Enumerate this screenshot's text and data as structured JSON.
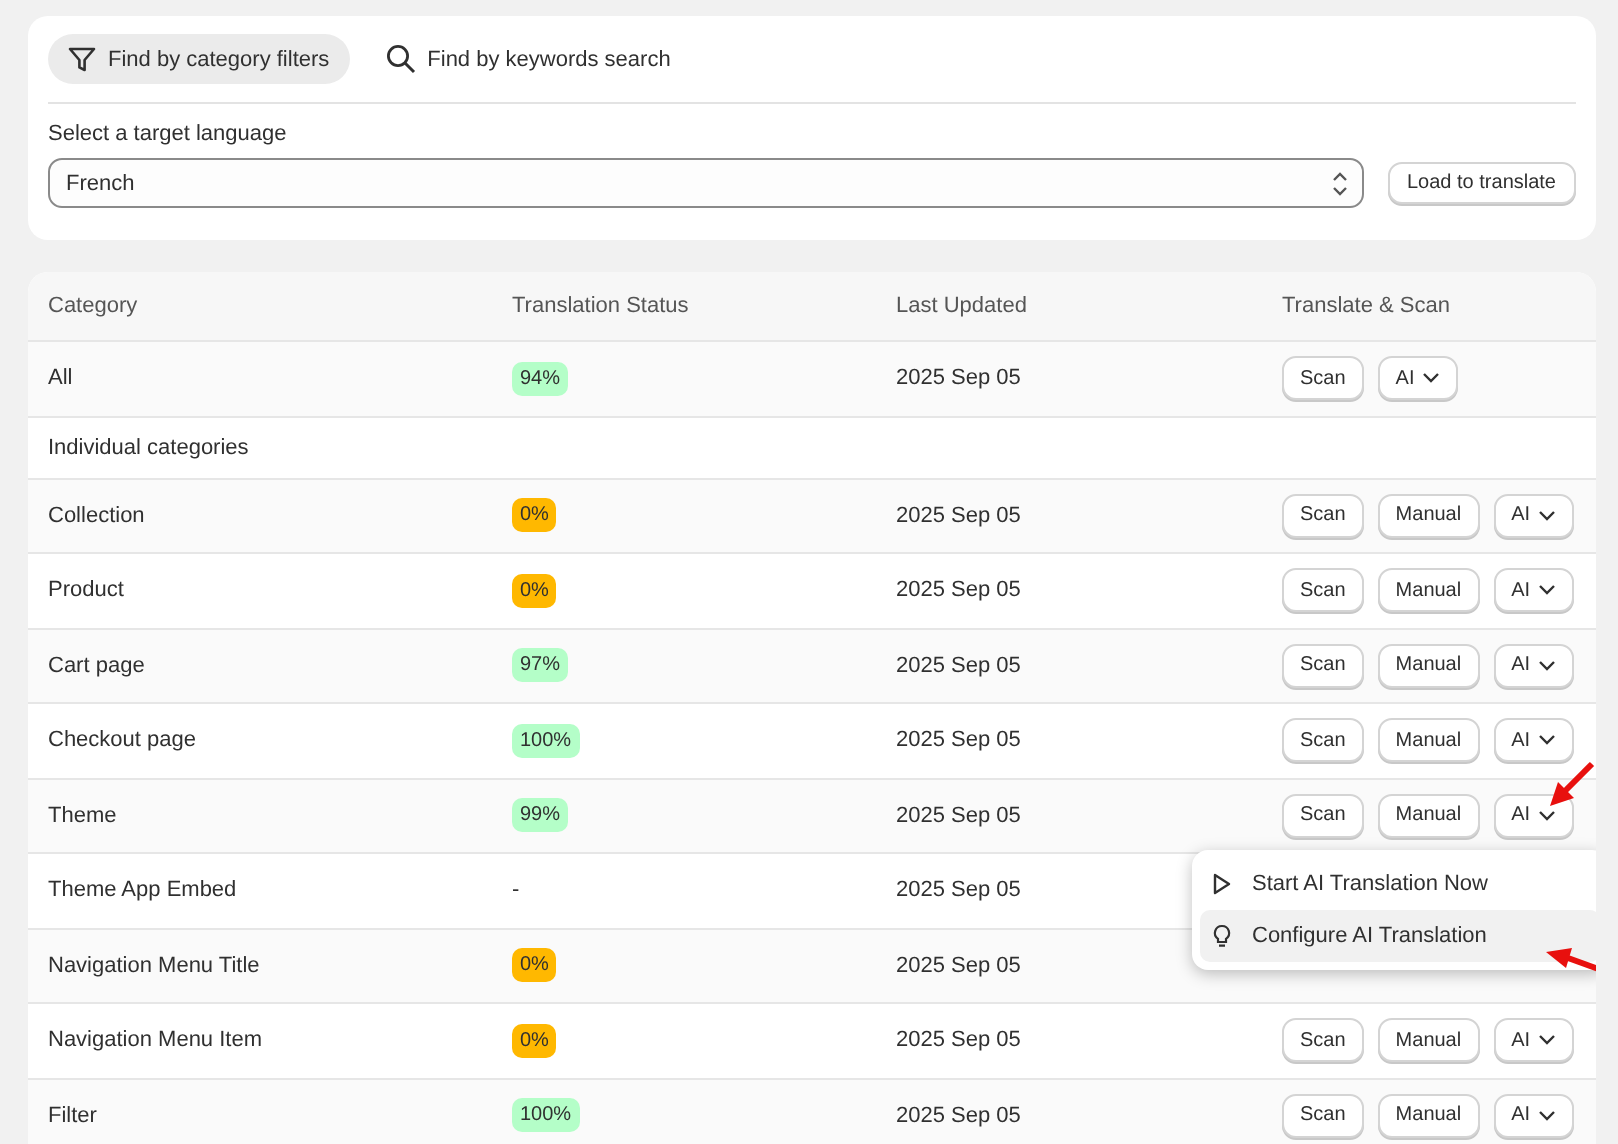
{
  "search_modes": [
    {
      "label": "Find by category filters",
      "selected": true
    },
    {
      "label": "Find by keywords search",
      "selected": false
    }
  ],
  "language": {
    "label": "Select a target language",
    "value": "French",
    "button": "Load to translate"
  },
  "table": {
    "columns": [
      "Category",
      "Translation Status",
      "Last Updated",
      "Translate & Scan"
    ],
    "rows": [
      {
        "kind": "item",
        "category": "All",
        "status": "94%",
        "color": "#b4fec8",
        "updated": "2025 Sep 05",
        "buttons": [
          "Scan",
          "AI"
        ]
      },
      {
        "kind": "heading",
        "category": "Individual categories"
      },
      {
        "kind": "item",
        "category": "Collection",
        "status": "0%",
        "color": "#ffb800",
        "updated": "2025 Sep 05",
        "buttons": [
          "Scan",
          "Manual",
          "AI"
        ]
      },
      {
        "kind": "item",
        "category": "Product",
        "status": "0%",
        "color": "#ffb800",
        "updated": "2025 Sep 05",
        "buttons": [
          "Scan",
          "Manual",
          "AI"
        ]
      },
      {
        "kind": "item",
        "category": "Cart page",
        "status": "97%",
        "color": "#b4fec8",
        "updated": "2025 Sep 05",
        "buttons": [
          "Scan",
          "Manual",
          "AI"
        ]
      },
      {
        "kind": "item",
        "category": "Checkout page",
        "status": "100%",
        "color": "#b4fec8",
        "updated": "2025 Sep 05",
        "buttons": [
          "Scan",
          "Manual",
          "AI"
        ]
      },
      {
        "kind": "item",
        "category": "Theme",
        "status": "99%",
        "color": "#b4fec8",
        "updated": "2025 Sep 05",
        "buttons": [
          "Scan",
          "Manual",
          "AI"
        ]
      },
      {
        "kind": "item",
        "category": "Theme App Embed",
        "status": "-",
        "updated": "2025 Sep 05"
      },
      {
        "kind": "item",
        "category": "Navigation Menu Title",
        "status": "0%",
        "color": "#ffb800",
        "updated": "2025 Sep 05"
      },
      {
        "kind": "item",
        "category": "Navigation Menu Item",
        "status": "0%",
        "color": "#ffb800",
        "updated": "2025 Sep 05",
        "buttons": [
          "Scan",
          "Manual",
          "AI"
        ]
      },
      {
        "kind": "item",
        "category": "Filter",
        "status": "100%",
        "color": "#b4fec8",
        "updated": "2025 Sep 05",
        "buttons": [
          "Scan",
          "Manual",
          "AI"
        ]
      }
    ]
  },
  "menu": {
    "items": [
      {
        "label": "Start AI Translation Now",
        "selected": false
      },
      {
        "label": "Configure AI Translation",
        "selected": true
      }
    ]
  }
}
